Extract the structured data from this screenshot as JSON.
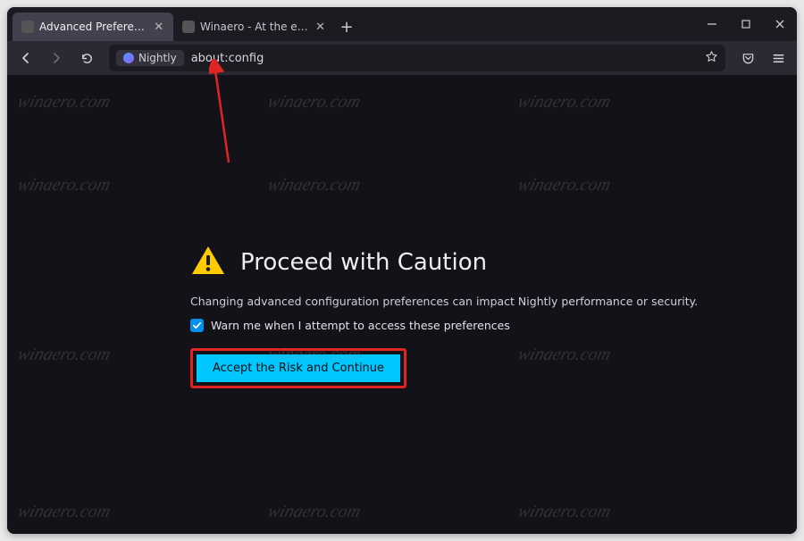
{
  "tabs": {
    "t0": {
      "label": "Advanced Preferences"
    },
    "t1": {
      "label": "Winaero - At the edge of tweaking"
    }
  },
  "urlbar": {
    "identity_label": "Nightly",
    "url": "about:config"
  },
  "caution": {
    "title": "Proceed with Caution",
    "description": "Changing advanced configuration preferences can impact Nightly performance or security.",
    "checkbox_label": "Warn me when I attempt to access these preferences",
    "accept_label": "Accept the Risk and Continue"
  },
  "watermark": "winaero.com"
}
